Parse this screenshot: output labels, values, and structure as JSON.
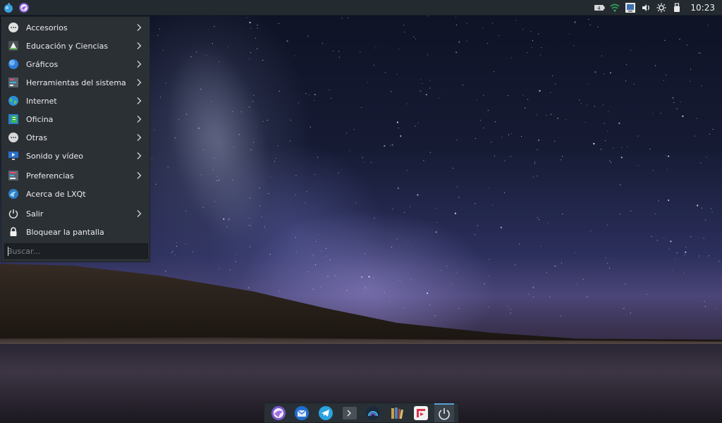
{
  "top_panel": {
    "launchers": [
      {
        "name": "app-menu-icon"
      },
      {
        "name": "firedragon-icon"
      }
    ],
    "tray": {
      "battery_text": "4",
      "clock": "10:23"
    }
  },
  "menu": {
    "items": [
      {
        "label": "Accesorios",
        "icon": "accessories-icon",
        "submenu": true
      },
      {
        "label": "Educación y Ciencias",
        "icon": "education-icon",
        "submenu": true
      },
      {
        "label": "Gráficos",
        "icon": "graphics-icon",
        "submenu": true
      },
      {
        "label": "Herramientas del sistema",
        "icon": "system-tools-icon",
        "submenu": true
      },
      {
        "label": "Internet",
        "icon": "internet-icon",
        "submenu": true
      },
      {
        "label": "Oficina",
        "icon": "office-icon",
        "submenu": true
      },
      {
        "label": "Otras",
        "icon": "other-icon",
        "submenu": true
      },
      {
        "label": "Sonido y vídeo",
        "icon": "multimedia-icon",
        "submenu": true
      },
      {
        "label": "Preferencias",
        "icon": "preferences-icon",
        "submenu": true
      },
      {
        "label": "Acerca de LXQt",
        "icon": "lxqt-icon",
        "submenu": false
      },
      {
        "label": "Salir",
        "icon": "power-icon",
        "submenu": true
      },
      {
        "label": "Bloquear la pantalla",
        "icon": "lock-icon",
        "submenu": false
      }
    ],
    "search_placeholder": "Buscar..."
  },
  "dock": {
    "items": [
      {
        "name": "firedragon-icon"
      },
      {
        "name": "thunderbird-icon"
      },
      {
        "name": "telegram-icon"
      },
      {
        "name": "terminal-icon"
      },
      {
        "name": "rainbow-icon"
      },
      {
        "name": "calibre-icon"
      },
      {
        "name": "freetube-icon"
      },
      {
        "name": "power-icon"
      }
    ]
  }
}
